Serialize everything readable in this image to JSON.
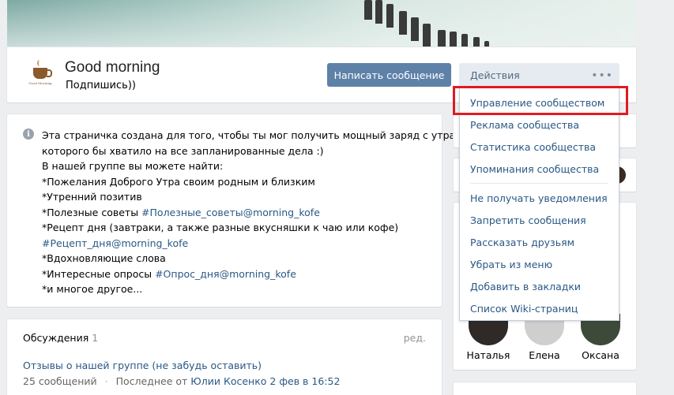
{
  "header": {
    "group_name": "Good morning",
    "status": "Подпишись))",
    "avatar_caption": "Good Morning",
    "write_message_button": "Написать сообщение",
    "actions_button": "Действия",
    "actions_more": "•••"
  },
  "actions_menu": {
    "items": [
      "Управление сообществом",
      "Реклама сообщества",
      "Статистика сообщества",
      "Упоминания сообщества",
      "Не получать уведомления",
      "Запретить сообщения",
      "Рассказать друзьям",
      "Убрать из меню",
      "Добавить в закладки",
      "Список Wiki-страниц"
    ]
  },
  "description": {
    "line1": "Эта страничка создана для того, чтобы ты мог получить мощный заряд с утра,",
    "line2": "которого бы хватило на все запланированные дела :)",
    "line3": "В нашей группе вы можете найти:",
    "line4": "*Пожелания Доброго Утра своим родным и близким",
    "line5": "*Утренний позитив",
    "line6_prefix": "*Полезные советы ",
    "line6_tag": "#Полезные_советы@morning_kofe",
    "line7": "*Рецепт дня (завтраки, а также разные вкусняшки к чаю или кофе)",
    "line8_tag": "#Рецепт_дня@morning_kofe",
    "line9": "*Вдохновляющие слова",
    "line10_prefix": "*Интересные опросы ",
    "line10_tag": "#Опрос_дня@morning_kofe",
    "line11": "*и многое другое..."
  },
  "discussions": {
    "title": "Обсуждения",
    "count": "1",
    "edit": "ред.",
    "topic": "Отзывы о нашей группе (не забудь оставить)",
    "messages": "25 сообщений",
    "separator": "·",
    "last_prefix": "Последнее от ",
    "last_author": "Юлии Косенко",
    "last_time": " 2 фев в 16:52"
  },
  "friends": [
    {
      "name": "Наталья"
    },
    {
      "name": "Елена"
    },
    {
      "name": "Оксана"
    }
  ],
  "colors": {
    "accent": "#5e81a8",
    "link": "#2a5885",
    "highlight": "#e01a22",
    "background": "#edeef0"
  }
}
